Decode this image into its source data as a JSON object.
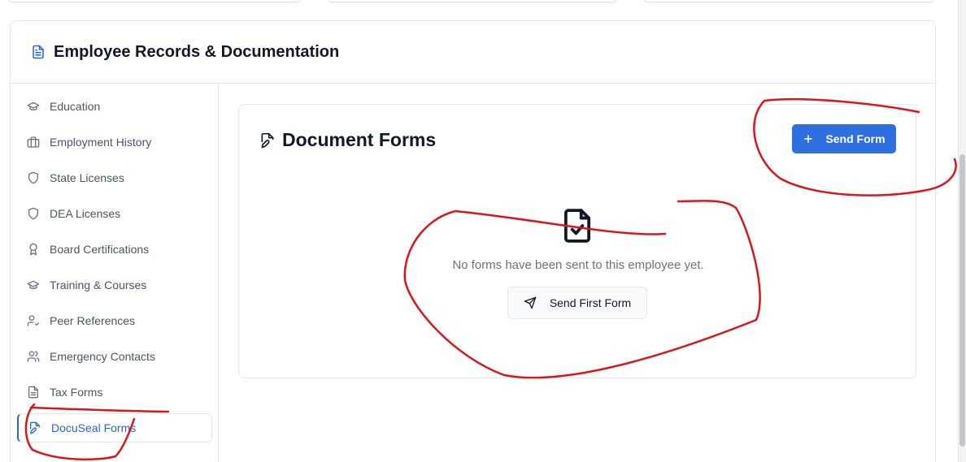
{
  "panel": {
    "title": "Employee Records & Documentation",
    "icon": "document-icon"
  },
  "sidebar": {
    "items": [
      {
        "label": "Education",
        "icon": "graduation-cap-icon"
      },
      {
        "label": "Employment History",
        "icon": "briefcase-icon"
      },
      {
        "label": "State Licenses",
        "icon": "shield-icon"
      },
      {
        "label": "DEA Licenses",
        "icon": "shield-icon"
      },
      {
        "label": "Board Certifications",
        "icon": "award-icon"
      },
      {
        "label": "Training & Courses",
        "icon": "graduation-cap-icon"
      },
      {
        "label": "Peer References",
        "icon": "user-check-icon"
      },
      {
        "label": "Emergency Contacts",
        "icon": "users-icon"
      },
      {
        "label": "Tax Forms",
        "icon": "file-text-icon"
      },
      {
        "label": "DocuSeal Forms",
        "icon": "file-edit-icon",
        "active": true
      }
    ]
  },
  "main": {
    "title": "Document Forms",
    "send_form_label": "Send Form",
    "empty_message": "No forms have been sent to this employee yet.",
    "send_first_label": "Send First Form"
  },
  "colors": {
    "accent": "#2f6fe0",
    "annotation": "#d9161c"
  }
}
